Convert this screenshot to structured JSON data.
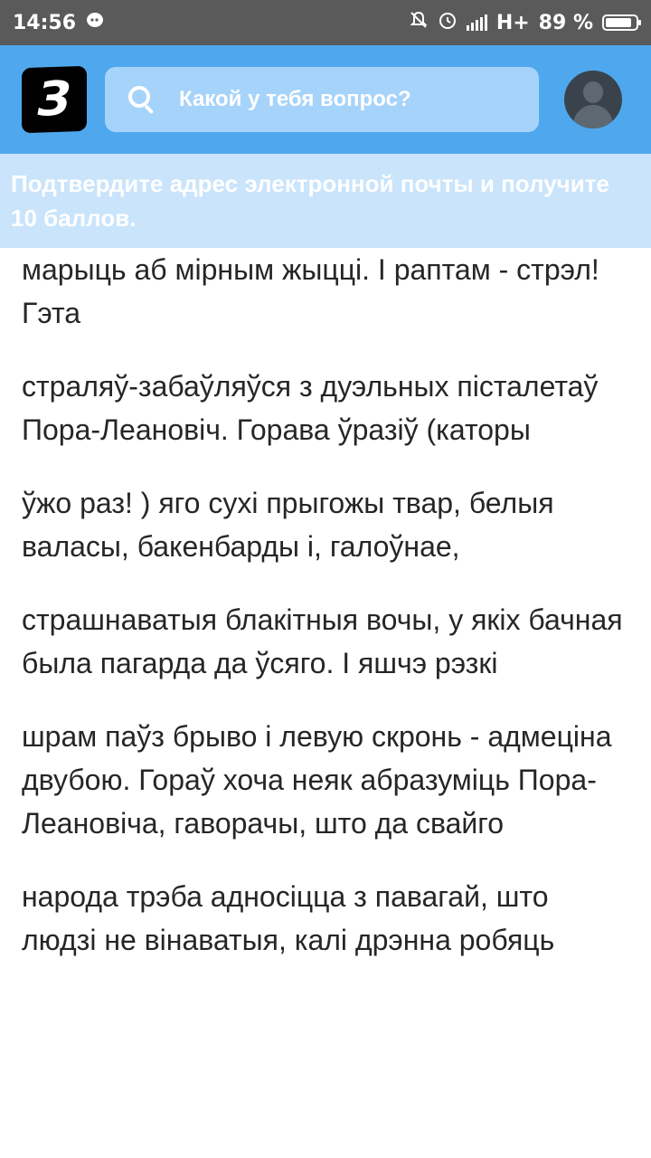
{
  "status_bar": {
    "time": "14:56",
    "network": "H+",
    "battery_percent": "89 %",
    "battery_level": 0.89,
    "icons": [
      "notification-icon",
      "mute-icon",
      "alarm-icon",
      "signal-icon",
      "battery-icon"
    ]
  },
  "header": {
    "logo_text": "З",
    "search": {
      "placeholder": "Какой у тебя вопрос?"
    },
    "colors": {
      "bar": "#4fa8ee",
      "search": "#a6d3fa",
      "avatar": "#3a434b"
    }
  },
  "banner": {
    "text": "Подтвердите адрес электронной почты и получите 10 баллов."
  },
  "content": {
    "paragraphs": [
      "марыць аб мірным жыцці. І раптам - стрэл! Гэта",
      "страляў-забаўляўся з дуэльных пісталетаў Пора-Леановіч. Горава ўразіў (каторы",
      "ўжо раз! ) яго сухі прыгожы твар, белыя валасы, бакенбарды і, галоўнае,",
      "страшнаватыя блакітныя вочы, у якіх бачная была пагарда да ўсяго. І яшчэ рэзкі",
      "шрам паўз брыво і левую скронь - адмеціна двубою.  Гораў хоча неяк абразуміць Пора-Леановіча, гаворачы, што да свайго",
      "народа трэба адносіцца з павагай, што людзі не вінаватыя, калі дрэнна робяць"
    ]
  }
}
